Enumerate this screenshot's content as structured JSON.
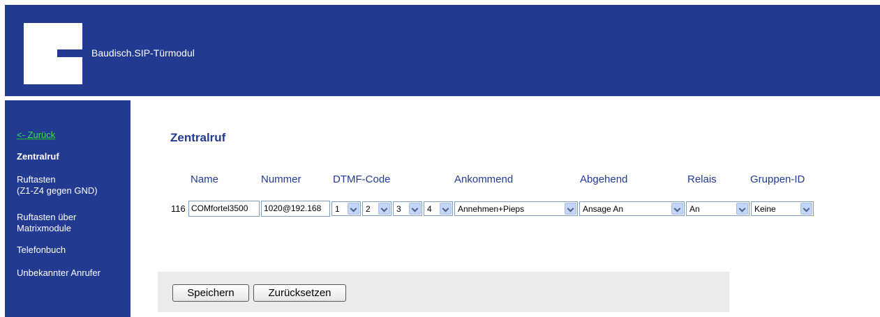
{
  "header": {
    "brand": "Baudisch.SIP-Türmodul"
  },
  "sidebar": {
    "back": "<- Zurück",
    "items": [
      {
        "label": "Zentralruf"
      },
      {
        "line1": "Ruftasten",
        "line2": "(Z1-Z4 gegen GND)"
      },
      {
        "line1": "Ruftasten über",
        "line2": "Matrixmodule"
      },
      {
        "label": "Telefonbuch"
      },
      {
        "label": "Unbekannter Anrufer"
      }
    ]
  },
  "main": {
    "title": "Zentralruf",
    "columns": [
      "Name",
      "Nummer",
      "DTMF-Code",
      "Ankommend",
      "Abgehend",
      "Relais",
      "Gruppen-ID"
    ],
    "row": {
      "number": "116",
      "name": "COMfortel3500",
      "nummer": "1020@192.168",
      "dtmf": [
        "1",
        "2",
        "3",
        "4"
      ],
      "ankommend": "Annehmen+Pieps",
      "abgehend": "Ansage An",
      "relais": "An",
      "gruppe": "Keine"
    },
    "buttons": {
      "save": "Speichern",
      "reset": "Zurücksetzen"
    }
  },
  "colors": {
    "primary": "#233a91",
    "back_link": "#3fe04a",
    "button_bar": "#ebebeb"
  }
}
